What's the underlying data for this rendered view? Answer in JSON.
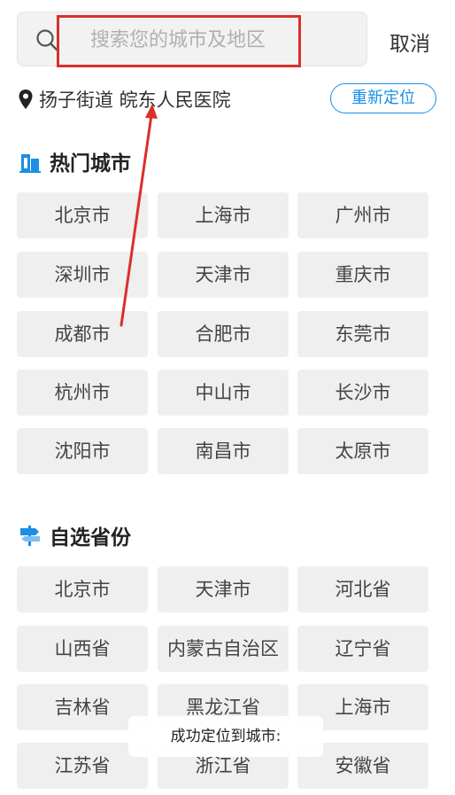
{
  "search": {
    "placeholder": "搜索您的城市及地区",
    "cancel_label": "取消"
  },
  "location": {
    "text": "扬子街道 皖东人民医院",
    "relocate_label": "重新定位"
  },
  "hot": {
    "title": "热门城市",
    "cities": [
      "北京市",
      "上海市",
      "广州市",
      "深圳市",
      "天津市",
      "重庆市",
      "成都市",
      "合肥市",
      "东莞市",
      "杭州市",
      "中山市",
      "长沙市",
      "沈阳市",
      "南昌市",
      "太原市"
    ]
  },
  "province": {
    "title": "自选省份",
    "items": [
      "北京市",
      "天津市",
      "河北省",
      "山西省",
      "内蒙古自治区",
      "辽宁省",
      "吉林省",
      "黑龙江省",
      "上海市",
      "江苏省",
      "浙江省",
      "安徽省"
    ]
  },
  "toast": {
    "text": "成功定位到城市:"
  },
  "colors": {
    "accent": "#1a8fe3",
    "annotation": "#d9302c"
  }
}
